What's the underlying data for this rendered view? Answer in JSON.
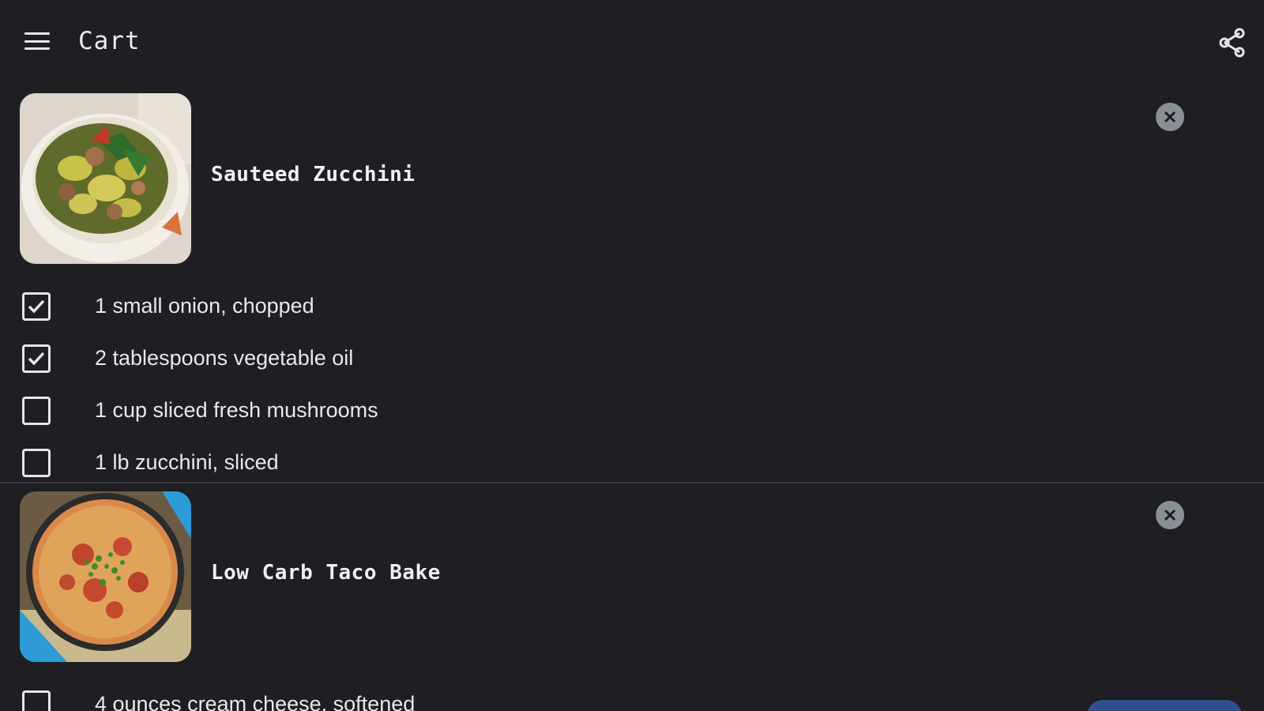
{
  "header": {
    "title": "Cart",
    "menu_icon": "hamburger-menu-icon",
    "share_icon": "share-icon"
  },
  "recipes": [
    {
      "name": "Sauteed Zucchini",
      "image_icon": "sauteed-zucchini-photo",
      "remove_icon": "close-circle-icon",
      "ingredients": [
        {
          "text": "1 small onion, chopped",
          "checked": true
        },
        {
          "text": "2 tablespoons vegetable oil",
          "checked": true
        },
        {
          "text": "1 cup sliced fresh mushrooms",
          "checked": false
        },
        {
          "text": "1 lb zucchini, sliced",
          "checked": false
        }
      ]
    },
    {
      "name": "Low Carb Taco Bake",
      "image_icon": "taco-bake-photo",
      "remove_icon": "close-circle-icon",
      "ingredients": [
        {
          "text": "4 ounces cream cheese, softened",
          "checked": false
        }
      ]
    }
  ],
  "colors": {
    "background": "#1e1e23",
    "text": "#e6e6e6",
    "remove_button": "#8a9196",
    "divider": "#3a3a40",
    "accent": "#2f4f8f"
  }
}
